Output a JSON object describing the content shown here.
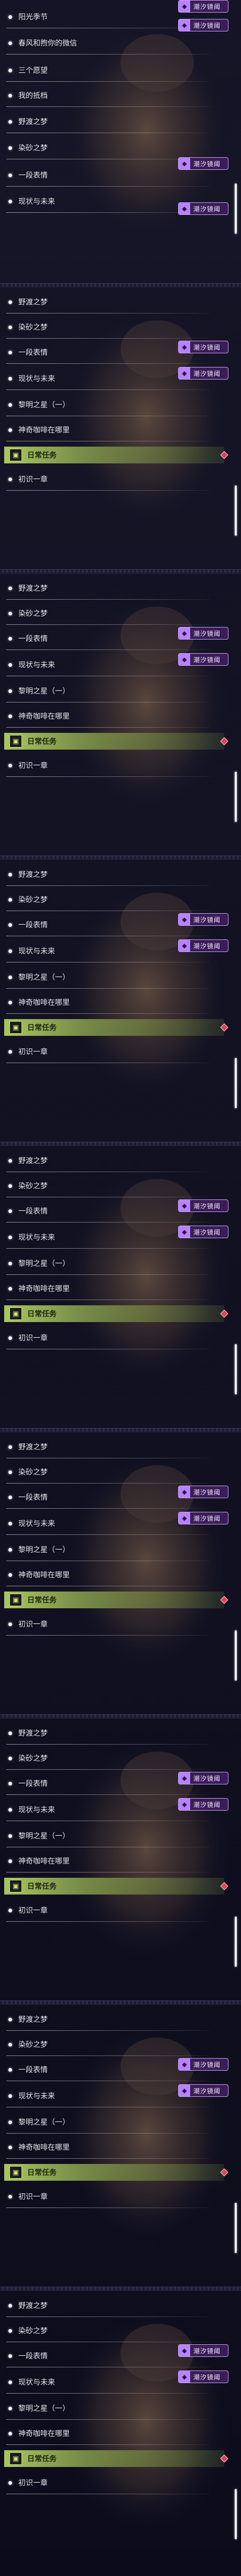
{
  "colors": {
    "badge_bg": "#3a1d55",
    "badge_border": "#c9a6ff",
    "daily_green": "#bada66",
    "gem_red": "#e0405a",
    "scrollbar": "#f4f4fa"
  },
  "icons": {
    "badge": "mask-icon",
    "daily": "book-icon",
    "gem": "gem-icon"
  },
  "badge_label": "潮汐镜阈",
  "daily_title": "日常任务",
  "daily_item": "初识一章",
  "first_panel": {
    "items": [
      "阳光季节",
      "春风和煦你的微信",
      "三个愿望",
      "我的抵档",
      "野渡之梦",
      "染砂之梦",
      "一段表情",
      "现状与未来"
    ]
  },
  "repeat_panel": {
    "items": [
      "野渡之梦",
      "染砂之梦",
      "一段表情",
      "现状与未来",
      "黎明之星（一）",
      "神奇咖啡在哪里"
    ]
  }
}
